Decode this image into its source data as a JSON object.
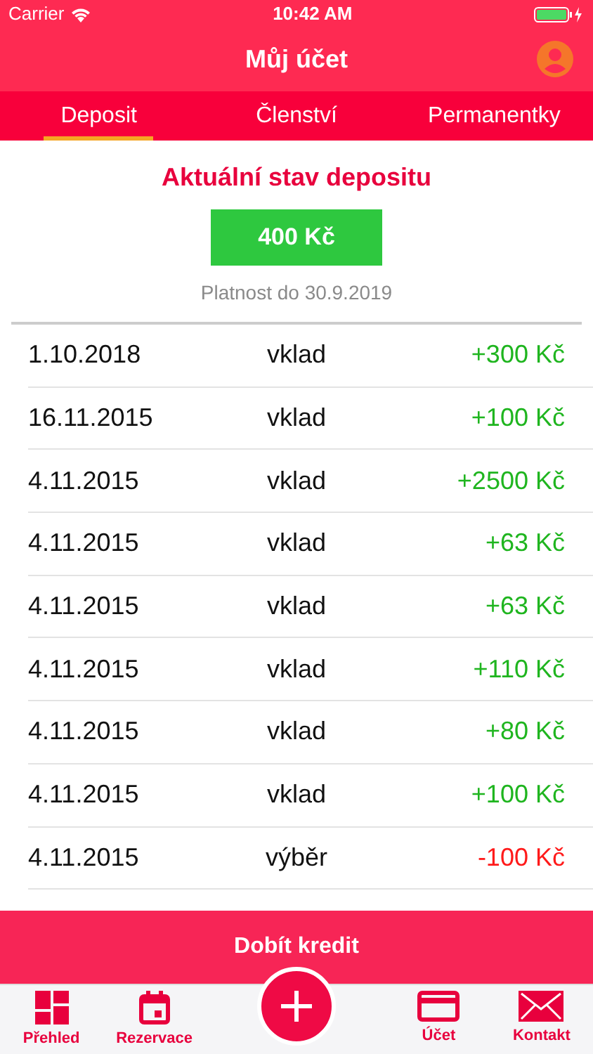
{
  "status_bar": {
    "carrier": "Carrier",
    "time": "10:42 AM"
  },
  "nav": {
    "title": "Můj účet"
  },
  "tabs": [
    {
      "label": "Deposit",
      "selected": true
    },
    {
      "label": "Členství",
      "selected": false
    },
    {
      "label": "Permanentky",
      "selected": false
    }
  ],
  "deposit": {
    "heading": "Aktuální stav depositu",
    "balance": "400 Kč",
    "validity": "Platnost do 30.9.2019"
  },
  "transactions": [
    {
      "date": "1.10.2018",
      "type": "vklad",
      "amount": "+300 Kč",
      "kind": "credit"
    },
    {
      "date": "16.11.2015",
      "type": "vklad",
      "amount": "+100 Kč",
      "kind": "credit"
    },
    {
      "date": "4.11.2015",
      "type": "vklad",
      "amount": "+2500 Kč",
      "kind": "credit"
    },
    {
      "date": "4.11.2015",
      "type": "vklad",
      "amount": "+63 Kč",
      "kind": "credit"
    },
    {
      "date": "4.11.2015",
      "type": "vklad",
      "amount": "+63 Kč",
      "kind": "credit"
    },
    {
      "date": "4.11.2015",
      "type": "vklad",
      "amount": "+110 Kč",
      "kind": "credit"
    },
    {
      "date": "4.11.2015",
      "type": "vklad",
      "amount": "+80 Kč",
      "kind": "credit"
    },
    {
      "date": "4.11.2015",
      "type": "vklad",
      "amount": "+100 Kč",
      "kind": "credit"
    },
    {
      "date": "4.11.2015",
      "type": "výběr",
      "amount": "-100 Kč",
      "kind": "debit"
    }
  ],
  "top_up_button": "Dobít kredit",
  "tab_bar": [
    {
      "label": "Přehled",
      "kind": "tab"
    },
    {
      "label": "Rezervace",
      "kind": "tab"
    },
    {
      "kind": "add"
    },
    {
      "label": "Účet",
      "kind": "tab"
    },
    {
      "label": "Kontakt",
      "kind": "tab"
    }
  ]
}
